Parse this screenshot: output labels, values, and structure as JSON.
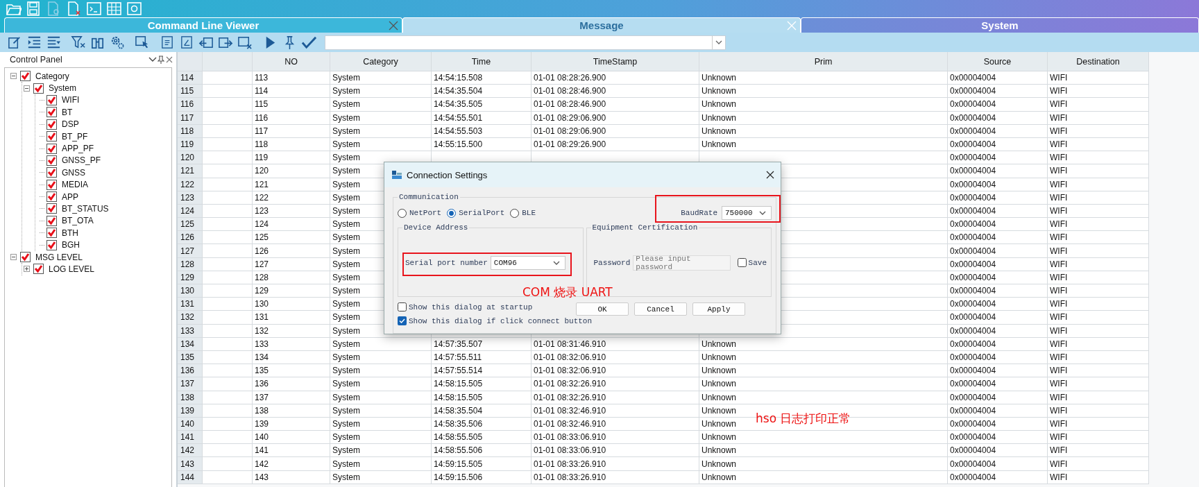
{
  "tabs": [
    {
      "label": "Command Line Viewer",
      "selected": true,
      "closable": true
    },
    {
      "label": "Message",
      "selected": false,
      "closable": true
    },
    {
      "label": "System",
      "selected": false,
      "closable": false
    }
  ],
  "control_panel": {
    "title": "Control Panel",
    "tree": [
      {
        "label": "Category",
        "checked": true,
        "expanded": true,
        "children": [
          {
            "label": "System",
            "checked": true,
            "expanded": true,
            "children": [
              {
                "label": "WIFI",
                "checked": true
              },
              {
                "label": "BT",
                "checked": true
              },
              {
                "label": "DSP",
                "checked": true
              },
              {
                "label": "BT_PF",
                "checked": true
              },
              {
                "label": "APP_PF",
                "checked": true
              },
              {
                "label": "GNSS_PF",
                "checked": true
              },
              {
                "label": "GNSS",
                "checked": true
              },
              {
                "label": "MEDIA",
                "checked": true
              },
              {
                "label": "APP",
                "checked": true
              },
              {
                "label": "BT_STATUS",
                "checked": true
              },
              {
                "label": "BT_OTA",
                "checked": true
              },
              {
                "label": "BTH",
                "checked": true
              },
              {
                "label": "BGH",
                "checked": true
              }
            ]
          }
        ]
      },
      {
        "label": "MSG LEVEL",
        "checked": true,
        "expanded": true,
        "children": [
          {
            "label": "LOG LEVEL",
            "checked": true,
            "expanded": false
          }
        ]
      }
    ]
  },
  "table": {
    "columns": [
      "NO",
      "Category",
      "Time",
      "TimeStamp",
      "Prim",
      "Source",
      "Destination"
    ],
    "rows": [
      {
        "index": "114",
        "no": "113",
        "category": "System",
        "time": "14:54:15.508",
        "timestamp": "01-01 08:28:26.900",
        "prim": "Unknown",
        "source": "0x00004004",
        "destination": "WIFI"
      },
      {
        "index": "115",
        "no": "114",
        "category": "System",
        "time": "14:54:35.504",
        "timestamp": "01-01 08:28:46.900",
        "prim": "Unknown",
        "source": "0x00004004",
        "destination": "WIFI"
      },
      {
        "index": "116",
        "no": "115",
        "category": "System",
        "time": "14:54:35.505",
        "timestamp": "01-01 08:28:46.900",
        "prim": "Unknown",
        "source": "0x00004004",
        "destination": "WIFI"
      },
      {
        "index": "117",
        "no": "116",
        "category": "System",
        "time": "14:54:55.501",
        "timestamp": "01-01 08:29:06.900",
        "prim": "Unknown",
        "source": "0x00004004",
        "destination": "WIFI"
      },
      {
        "index": "118",
        "no": "117",
        "category": "System",
        "time": "14:54:55.503",
        "timestamp": "01-01 08:29:06.900",
        "prim": "Unknown",
        "source": "0x00004004",
        "destination": "WIFI"
      },
      {
        "index": "119",
        "no": "118",
        "category": "System",
        "time": "14:55:15.500",
        "timestamp": "01-01 08:29:26.900",
        "prim": "Unknown",
        "source": "0x00004004",
        "destination": "WIFI"
      },
      {
        "index": "120",
        "no": "119",
        "category": "System",
        "source": "0x00004004",
        "destination": "WIFI"
      },
      {
        "index": "121",
        "no": "120",
        "category": "System",
        "source": "0x00004004",
        "destination": "WIFI"
      },
      {
        "index": "122",
        "no": "121",
        "category": "System",
        "source": "0x00004004",
        "destination": "WIFI"
      },
      {
        "index": "123",
        "no": "122",
        "category": "System",
        "source": "0x00004004",
        "destination": "WIFI"
      },
      {
        "index": "124",
        "no": "123",
        "category": "System",
        "source": "0x00004004",
        "destination": "WIFI"
      },
      {
        "index": "125",
        "no": "124",
        "category": "System",
        "source": "0x00004004",
        "destination": "WIFI"
      },
      {
        "index": "126",
        "no": "125",
        "category": "System",
        "source": "0x00004004",
        "destination": "WIFI"
      },
      {
        "index": "127",
        "no": "126",
        "category": "System",
        "source": "0x00004004",
        "destination": "WIFI"
      },
      {
        "index": "128",
        "no": "127",
        "category": "System",
        "source": "0x00004004",
        "destination": "WIFI"
      },
      {
        "index": "129",
        "no": "128",
        "category": "System",
        "source": "0x00004004",
        "destination": "WIFI"
      },
      {
        "index": "130",
        "no": "129",
        "category": "System",
        "source": "0x00004004",
        "destination": "WIFI"
      },
      {
        "index": "131",
        "no": "130",
        "category": "System",
        "source": "0x00004004",
        "destination": "WIFI"
      },
      {
        "index": "132",
        "no": "131",
        "category": "System",
        "source": "0x00004004",
        "destination": "WIFI"
      },
      {
        "index": "133",
        "no": "132",
        "category": "System",
        "source": "0x00004004",
        "destination": "WIFI"
      },
      {
        "index": "134",
        "no": "133",
        "category": "System",
        "time": "14:57:35.507",
        "timestamp": "01-01 08:31:46.910",
        "prim": "Unknown",
        "source": "0x00004004",
        "destination": "WIFI"
      },
      {
        "index": "135",
        "no": "134",
        "category": "System",
        "time": "14:57:55.511",
        "timestamp": "01-01 08:32:06.910",
        "prim": "Unknown",
        "source": "0x00004004",
        "destination": "WIFI"
      },
      {
        "index": "136",
        "no": "135",
        "category": "System",
        "time": "14:57:55.514",
        "timestamp": "01-01 08:32:06.910",
        "prim": "Unknown",
        "source": "0x00004004",
        "destination": "WIFI"
      },
      {
        "index": "137",
        "no": "136",
        "category": "System",
        "time": "14:58:15.505",
        "timestamp": "01-01 08:32:26.910",
        "prim": "Unknown",
        "source": "0x00004004",
        "destination": "WIFI"
      },
      {
        "index": "138",
        "no": "137",
        "category": "System",
        "time": "14:58:15.505",
        "timestamp": "01-01 08:32:26.910",
        "prim": "Unknown",
        "source": "0x00004004",
        "destination": "WIFI"
      },
      {
        "index": "139",
        "no": "138",
        "category": "System",
        "time": "14:58:35.504",
        "timestamp": "01-01 08:32:46.910",
        "prim": "Unknown",
        "source": "0x00004004",
        "destination": "WIFI"
      },
      {
        "index": "140",
        "no": "139",
        "category": "System",
        "time": "14:58:35.506",
        "timestamp": "01-01 08:32:46.910",
        "prim": "Unknown",
        "source": "0x00004004",
        "destination": "WIFI"
      },
      {
        "index": "141",
        "no": "140",
        "category": "System",
        "time": "14:58:55.505",
        "timestamp": "01-01 08:33:06.910",
        "prim": "Unknown",
        "source": "0x00004004",
        "destination": "WIFI"
      },
      {
        "index": "142",
        "no": "141",
        "category": "System",
        "time": "14:58:55.506",
        "timestamp": "01-01 08:33:06.910",
        "prim": "Unknown",
        "source": "0x00004004",
        "destination": "WIFI"
      },
      {
        "index": "143",
        "no": "142",
        "category": "System",
        "time": "14:59:15.505",
        "timestamp": "01-01 08:33:26.910",
        "prim": "Unknown",
        "source": "0x00004004",
        "destination": "WIFI"
      },
      {
        "index": "144",
        "no": "143",
        "category": "System",
        "time": "14:59:15.506",
        "timestamp": "01-01 08:33:26.910",
        "prim": "Unknown",
        "source": "0x00004004",
        "destination": "WIFI"
      }
    ]
  },
  "dialog": {
    "title": "Connection Settings",
    "communication": {
      "legend": "Communication",
      "options": [
        {
          "label": "NetPort",
          "selected": false
        },
        {
          "label": "SerialPort",
          "selected": true
        },
        {
          "label": "BLE",
          "selected": false
        }
      ],
      "baud_label": "BaudRate",
      "baud_value": "750000"
    },
    "device_address": {
      "legend": "Device Address",
      "label": "Serial port number",
      "value": "COM96"
    },
    "certification": {
      "legend": "Equipment Certification",
      "password_label": "Password",
      "password_placeholder": "Please input password",
      "save_label": "Save",
      "save_checked": false
    },
    "checkboxes": [
      {
        "label": "Show this dialog at startup",
        "checked": false
      },
      {
        "label": "Show this dialog if click connect button",
        "checked": true
      }
    ],
    "buttons": [
      "OK",
      "Cancel",
      "Apply"
    ]
  },
  "annotations": [
    {
      "text": "COM 烧录 UART"
    },
    {
      "text": "hso 日志打印正常"
    }
  ]
}
